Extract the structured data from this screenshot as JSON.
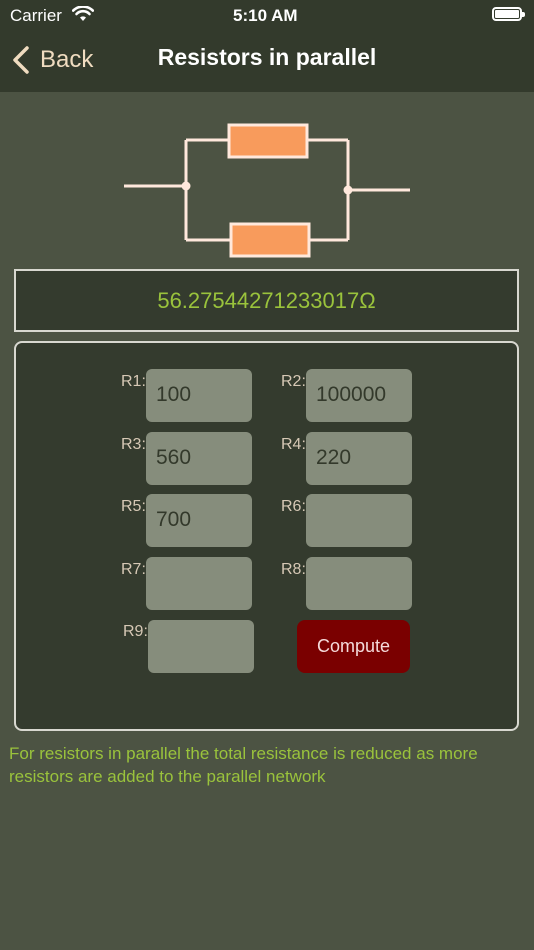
{
  "status_bar": {
    "carrier": "Carrier",
    "time": "5:10 AM"
  },
  "nav": {
    "back_label": "Back",
    "title": "Resistors in parallel"
  },
  "result": {
    "value": "56.27544271233017Ω"
  },
  "fields": [
    {
      "label": "R1:",
      "value": "100"
    },
    {
      "label": "R2:",
      "value": "100000"
    },
    {
      "label": "R3:",
      "value": "560"
    },
    {
      "label": "R4:",
      "value": "220"
    },
    {
      "label": "R5:",
      "value": "700"
    },
    {
      "label": "R6:",
      "value": ""
    },
    {
      "label": "R7:",
      "value": ""
    },
    {
      "label": "R8:",
      "value": ""
    },
    {
      "label": "R9:",
      "value": ""
    }
  ],
  "compute_label": "Compute",
  "footer_note": "For resistors in parallel the total resistance is reduced as more resistors are added to the parallel network",
  "colors": {
    "background": "#4c5343",
    "bar": "#333a2c",
    "panel": "#343b2e",
    "accent_text": "#9ac33c",
    "resistor": "#f89b5c",
    "compute": "#7a0000",
    "field": "#868d7c"
  },
  "icons": {
    "back": "chevron-left-icon",
    "wifi": "wifi-icon",
    "battery": "battery-icon",
    "diagram": "parallel-resistor-circuit"
  }
}
